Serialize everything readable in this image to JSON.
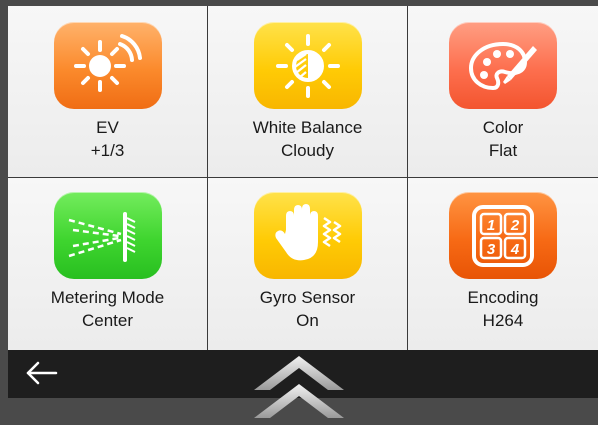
{
  "tiles": [
    {
      "title": "EV",
      "value": "+1/3",
      "icon": "sun-exposure-icon",
      "color": "#f98a2c"
    },
    {
      "title": "White Balance",
      "value": "Cloudy",
      "icon": "white-balance-icon",
      "color": "#ffcb05"
    },
    {
      "title": "Color",
      "value": "Flat",
      "icon": "palette-icon",
      "color": "#fd6f4e"
    },
    {
      "title": "Metering Mode",
      "value": "Center",
      "icon": "metering-icon",
      "color": "#3fd52f"
    },
    {
      "title": "Gyro Sensor",
      "value": "On",
      "icon": "gyro-hand-icon",
      "color": "#ffcb05"
    },
    {
      "title": "Encoding",
      "value": "H264",
      "icon": "encoding-grid-icon",
      "color": "#f76a15"
    }
  ],
  "encoding_grid": [
    "1",
    "2",
    "3",
    "4"
  ],
  "nav": {
    "back_icon": "back-arrow-icon",
    "expand_icon": "chevron-up-icon"
  }
}
